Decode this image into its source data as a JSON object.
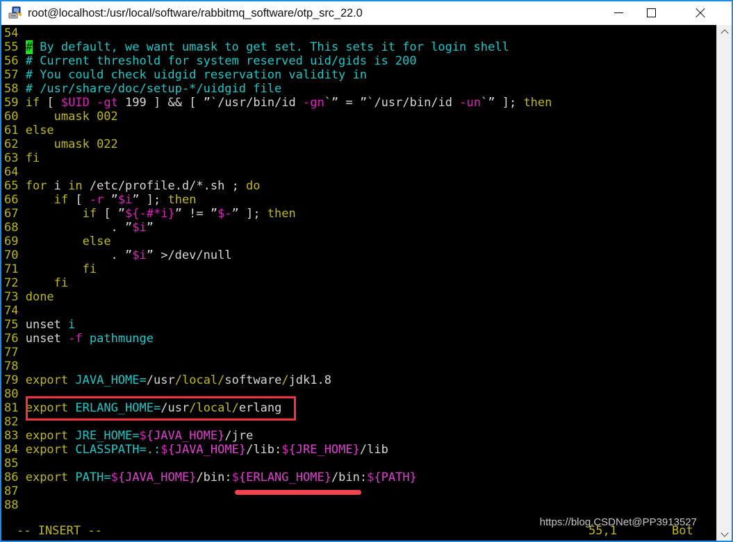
{
  "window": {
    "title": "root@localhost:/usr/local/software/rabbitmq_software/otp_src_22.0",
    "icon": "remote-computer-icon",
    "minimize_label": "—",
    "maximize_label": "□",
    "close_label": "✕",
    "accent_color": "#1b8ae8"
  },
  "terminal": {
    "background": "#000000",
    "foreground": "#d8d8d8",
    "editor": "vim",
    "filename": "/etc/profile",
    "lines": [
      {
        "num": "54",
        "tokens": []
      },
      {
        "num": "55",
        "tokens": [
          {
            "t": "#",
            "c": "cursor"
          },
          {
            "t": " By default, we want umask to get set. This sets it for login shell",
            "c": "c-cyan"
          }
        ]
      },
      {
        "num": "56",
        "tokens": [
          {
            "t": "# Current threshold for system reserved uid/gids is 200",
            "c": "c-cyan"
          }
        ]
      },
      {
        "num": "57",
        "tokens": [
          {
            "t": "# You could check uidgid reservation validity in",
            "c": "c-cyan"
          }
        ]
      },
      {
        "num": "58",
        "tokens": [
          {
            "t": "# /usr/share/doc/setup-*/uidgid file",
            "c": "c-cyan"
          }
        ]
      },
      {
        "num": "59",
        "tokens": [
          {
            "t": "if",
            "c": "c-yellow"
          },
          {
            "t": " [ ",
            "c": "c-white"
          },
          {
            "t": "$UID",
            "c": "c-magenta"
          },
          {
            "t": " ",
            "c": "c-white"
          },
          {
            "t": "-gt",
            "c": "c-magenta"
          },
          {
            "t": " 199 ] ",
            "c": "c-white"
          },
          {
            "t": "&&",
            "c": "c-white"
          },
          {
            "t": " [ ",
            "c": "c-white"
          },
          {
            "t": "”`",
            "c": "c-white"
          },
          {
            "t": "/usr/bin/id",
            "c": "c-white"
          },
          {
            "t": " ",
            "c": "c-white"
          },
          {
            "t": "-gn",
            "c": "c-magenta"
          },
          {
            "t": "`”",
            "c": "c-white"
          },
          {
            "t": " = ",
            "c": "c-white"
          },
          {
            "t": "”`",
            "c": "c-white"
          },
          {
            "t": "/usr/bin/id",
            "c": "c-white"
          },
          {
            "t": " ",
            "c": "c-white"
          },
          {
            "t": "-un",
            "c": "c-magenta"
          },
          {
            "t": "`”",
            "c": "c-white"
          },
          {
            "t": " ]; ",
            "c": "c-white"
          },
          {
            "t": "then",
            "c": "c-yellow"
          }
        ]
      },
      {
        "num": "60",
        "tokens": [
          {
            "t": "    umask 002",
            "c": "c-yellow"
          }
        ]
      },
      {
        "num": "61",
        "tokens": [
          {
            "t": "else",
            "c": "c-yellow"
          }
        ]
      },
      {
        "num": "62",
        "tokens": [
          {
            "t": "    umask 022",
            "c": "c-yellow"
          }
        ]
      },
      {
        "num": "63",
        "tokens": [
          {
            "t": "fi",
            "c": "c-yellow"
          }
        ]
      },
      {
        "num": "64",
        "tokens": []
      },
      {
        "num": "65",
        "tokens": [
          {
            "t": "for",
            "c": "c-yellow"
          },
          {
            "t": " i ",
            "c": "c-white"
          },
          {
            "t": "in",
            "c": "c-yellow"
          },
          {
            "t": " /etc/profile.d/*.sh ; ",
            "c": "c-white"
          },
          {
            "t": "do",
            "c": "c-yellow"
          }
        ]
      },
      {
        "num": "66",
        "tokens": [
          {
            "t": "    ",
            "c": "c-white"
          },
          {
            "t": "if",
            "c": "c-yellow"
          },
          {
            "t": " [ ",
            "c": "c-white"
          },
          {
            "t": "-r",
            "c": "c-magenta"
          },
          {
            "t": " ”",
            "c": "c-white"
          },
          {
            "t": "$i",
            "c": "c-magenta"
          },
          {
            "t": "” ]; ",
            "c": "c-white"
          },
          {
            "t": "then",
            "c": "c-yellow"
          }
        ]
      },
      {
        "num": "67",
        "tokens": [
          {
            "t": "        ",
            "c": "c-white"
          },
          {
            "t": "if",
            "c": "c-yellow"
          },
          {
            "t": " [ ”",
            "c": "c-white"
          },
          {
            "t": "${-#*i}",
            "c": "c-magenta"
          },
          {
            "t": "” != ”",
            "c": "c-white"
          },
          {
            "t": "$-",
            "c": "c-magenta"
          },
          {
            "t": "” ]; ",
            "c": "c-white"
          },
          {
            "t": "then",
            "c": "c-yellow"
          }
        ]
      },
      {
        "num": "68",
        "tokens": [
          {
            "t": "            . ”",
            "c": "c-white"
          },
          {
            "t": "$i",
            "c": "c-magenta"
          },
          {
            "t": "”",
            "c": "c-white"
          }
        ]
      },
      {
        "num": "69",
        "tokens": [
          {
            "t": "        ",
            "c": "c-white"
          },
          {
            "t": "else",
            "c": "c-yellow"
          }
        ]
      },
      {
        "num": "70",
        "tokens": [
          {
            "t": "            . ”",
            "c": "c-white"
          },
          {
            "t": "$i",
            "c": "c-magenta"
          },
          {
            "t": "” >/dev/null",
            "c": "c-white"
          }
        ]
      },
      {
        "num": "71",
        "tokens": [
          {
            "t": "        ",
            "c": "c-white"
          },
          {
            "t": "fi",
            "c": "c-yellow"
          }
        ]
      },
      {
        "num": "72",
        "tokens": [
          {
            "t": "    ",
            "c": "c-white"
          },
          {
            "t": "fi",
            "c": "c-yellow"
          }
        ]
      },
      {
        "num": "73",
        "tokens": [
          {
            "t": "done",
            "c": "c-yellow"
          }
        ]
      },
      {
        "num": "74",
        "tokens": []
      },
      {
        "num": "75",
        "tokens": [
          {
            "t": "unset",
            "c": "c-white"
          },
          {
            "t": " ",
            "c": "c-white"
          },
          {
            "t": "i",
            "c": "c-cyan"
          }
        ]
      },
      {
        "num": "76",
        "tokens": [
          {
            "t": "unset",
            "c": "c-white"
          },
          {
            "t": " ",
            "c": "c-white"
          },
          {
            "t": "-f",
            "c": "c-magenta"
          },
          {
            "t": " ",
            "c": "c-white"
          },
          {
            "t": "pathmunge",
            "c": "c-cyan"
          }
        ]
      },
      {
        "num": "77",
        "tokens": []
      },
      {
        "num": "78",
        "tokens": []
      },
      {
        "num": "79",
        "tokens": [
          {
            "t": "export",
            "c": "c-yellow"
          },
          {
            "t": " ",
            "c": "c-white"
          },
          {
            "t": "JAVA_HOME",
            "c": "c-cyan"
          },
          {
            "t": "=",
            "c": "c-cyan"
          },
          {
            "t": "/",
            "c": "c-white"
          },
          {
            "t": "usr",
            "c": "c-white"
          },
          {
            "t": "/",
            "c": "c-yellow"
          },
          {
            "t": "local",
            "c": "c-yellow"
          },
          {
            "t": "/",
            "c": "c-yellow"
          },
          {
            "t": "software",
            "c": "c-white"
          },
          {
            "t": "/",
            "c": "c-yellow"
          },
          {
            "t": "jdk1.8",
            "c": "c-white"
          }
        ]
      },
      {
        "num": "80",
        "tokens": []
      },
      {
        "num": "81",
        "tokens": [
          {
            "t": "export",
            "c": "c-yellow"
          },
          {
            "t": " ",
            "c": "c-white"
          },
          {
            "t": "ERLANG_HOME",
            "c": "c-cyan"
          },
          {
            "t": "=",
            "c": "c-cyan"
          },
          {
            "t": "/",
            "c": "c-white"
          },
          {
            "t": "usr",
            "c": "c-white"
          },
          {
            "t": "/",
            "c": "c-yellow"
          },
          {
            "t": "local",
            "c": "c-yellow"
          },
          {
            "t": "/",
            "c": "c-yellow"
          },
          {
            "t": "erlang",
            "c": "c-white"
          }
        ]
      },
      {
        "num": "82",
        "tokens": []
      },
      {
        "num": "83",
        "tokens": [
          {
            "t": "export",
            "c": "c-yellow"
          },
          {
            "t": " ",
            "c": "c-white"
          },
          {
            "t": "JRE_HOME",
            "c": "c-cyan"
          },
          {
            "t": "=",
            "c": "c-cyan"
          },
          {
            "t": "$",
            "c": "c-magenta"
          },
          {
            "t": "{JAVA_HOME}",
            "c": "c-pink"
          },
          {
            "t": "/jre",
            "c": "c-white"
          }
        ]
      },
      {
        "num": "84",
        "tokens": [
          {
            "t": "export",
            "c": "c-yellow"
          },
          {
            "t": " ",
            "c": "c-white"
          },
          {
            "t": "CLASSPATH",
            "c": "c-cyan"
          },
          {
            "t": "=.:",
            "c": "c-cyan"
          },
          {
            "t": "$",
            "c": "c-magenta"
          },
          {
            "t": "{JAVA_HOME}",
            "c": "c-pink"
          },
          {
            "t": "/lib:",
            "c": "c-white"
          },
          {
            "t": "$",
            "c": "c-magenta"
          },
          {
            "t": "{JRE_HOME}",
            "c": "c-pink"
          },
          {
            "t": "/lib",
            "c": "c-white"
          }
        ]
      },
      {
        "num": "85",
        "tokens": []
      },
      {
        "num": "86",
        "tokens": [
          {
            "t": "export",
            "c": "c-yellow"
          },
          {
            "t": " ",
            "c": "c-white"
          },
          {
            "t": "PATH",
            "c": "c-cyan"
          },
          {
            "t": "=",
            "c": "c-cyan"
          },
          {
            "t": "$",
            "c": "c-magenta"
          },
          {
            "t": "{JAVA_HOME}",
            "c": "c-pink"
          },
          {
            "t": "/bin:",
            "c": "c-white"
          },
          {
            "t": "$",
            "c": "c-magenta"
          },
          {
            "t": "{ERLANG_HOME}",
            "c": "c-pink"
          },
          {
            "t": "/bin:",
            "c": "c-white"
          },
          {
            "t": "$",
            "c": "c-magenta"
          },
          {
            "t": "{PATH}",
            "c": "c-pink"
          }
        ]
      },
      {
        "num": "87",
        "tokens": []
      },
      {
        "num": "88",
        "tokens": []
      }
    ],
    "status": {
      "mode": "-- INSERT --",
      "position": "55,1",
      "scroll": "Bot"
    }
  },
  "annotations": {
    "box_color": "#f5333f",
    "underline_color": "#f5434f",
    "box_target": "export ERLANG_HOME=/usr/local/erlang",
    "underline_target": "${ERLANG_HOME}"
  },
  "watermark": {
    "text": "https://blog.CSDNet@PP3913527"
  },
  "scrollbar": {
    "up_arrow": "chevron-up-icon",
    "down_arrow": "chevron-down-icon"
  }
}
